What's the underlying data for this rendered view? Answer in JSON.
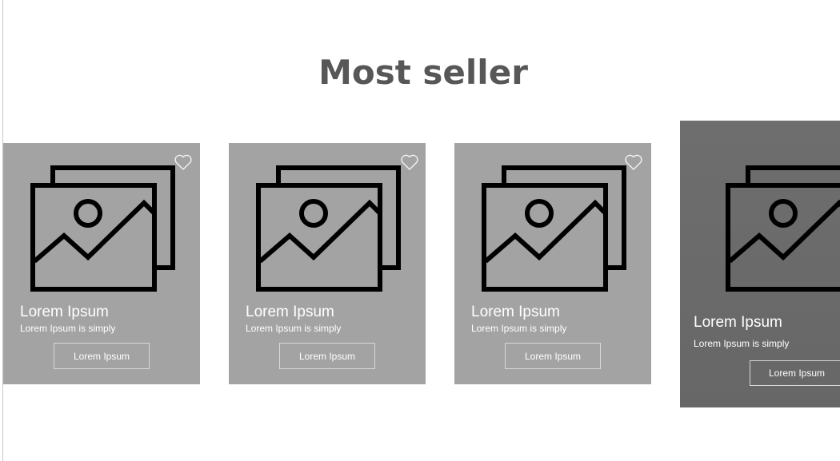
{
  "section": {
    "title": "Most seller"
  },
  "products": [
    {
      "name": "Lorem Ipsum",
      "description": "Lorem Ipsum is simply",
      "button_label": "Lorem Ipsum",
      "icon": "image-gallery-icon",
      "favorite_icon": "heart-outline-icon"
    },
    {
      "name": "Lorem Ipsum",
      "description": "Lorem Ipsum is simply",
      "button_label": "Lorem Ipsum",
      "icon": "image-gallery-icon",
      "favorite_icon": "heart-outline-icon"
    },
    {
      "name": "Lorem Ipsum",
      "description": "Lorem Ipsum is simply",
      "button_label": "Lorem Ipsum",
      "icon": "image-gallery-icon",
      "favorite_icon": "heart-outline-icon"
    },
    {
      "name": "Lorem Ipsum",
      "description": "Lorem Ipsum is simply",
      "button_label": "Lorem Ipsum",
      "icon": "image-gallery-icon",
      "state": "highlighted"
    }
  ],
  "colors": {
    "card": "#a3a3a3",
    "card_highlighted": "#6b6b6b",
    "title": "#575757",
    "text": "#ffffff"
  }
}
